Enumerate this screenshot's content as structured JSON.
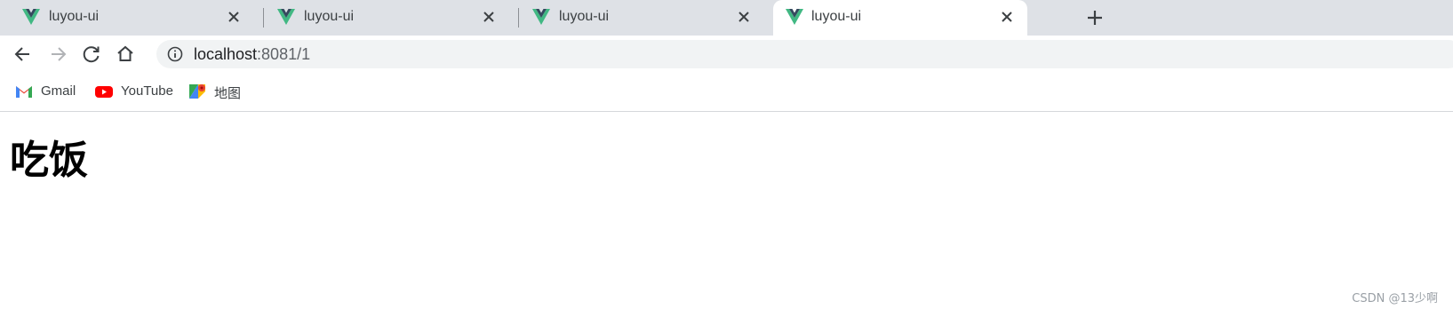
{
  "browser": {
    "tabs": [
      {
        "title": "luyou-ui",
        "active": false
      },
      {
        "title": "luyou-ui",
        "active": false
      },
      {
        "title": "luyou-ui",
        "active": false
      },
      {
        "title": "luyou-ui",
        "active": true
      }
    ],
    "url_host": "localhost",
    "url_rest": ":8081/1",
    "bookmarks": [
      {
        "label": "Gmail",
        "icon": "gmail-icon"
      },
      {
        "label": "YouTube",
        "icon": "youtube-icon"
      },
      {
        "label": "地图",
        "icon": "maps-icon"
      }
    ]
  },
  "page": {
    "heading": "吃饭"
  },
  "watermark": "CSDN @13少啊",
  "colors": {
    "tabstrip": "#dee1e6",
    "vue_green": "#41b883",
    "vue_dark": "#35495e",
    "youtube_red": "#ff0000"
  }
}
